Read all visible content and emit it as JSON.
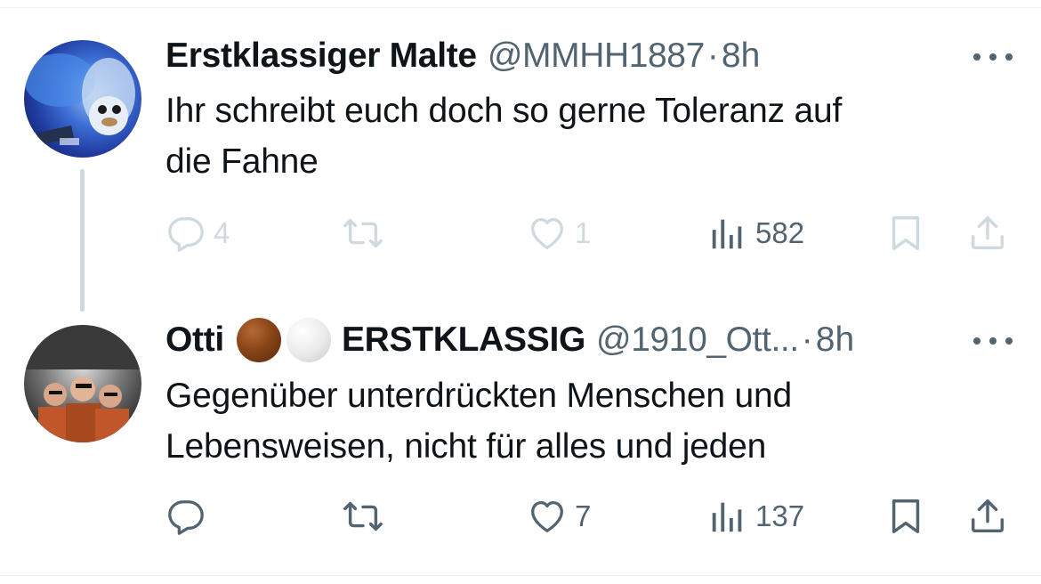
{
  "tweets": [
    {
      "name": "Erstklassiger Malte",
      "handle": "@MMHH1887",
      "separator": "·",
      "time": "8h",
      "text_lines": [
        "Ihr schreibt euch doch so gerne Toleranz auf",
        "die Fahne"
      ],
      "actions": {
        "replies": "4",
        "retweets": "",
        "likes": "1",
        "views": "582"
      },
      "icons": [
        "reply-icon",
        "retweet-icon",
        "heart-icon",
        "views-icon",
        "bookmark-icon",
        "share-icon",
        "more-icon"
      ]
    },
    {
      "name": "Otti",
      "name_suffix": "ERSTKLASSIG",
      "handle": "@1910_Ott...",
      "separator": "·",
      "time": "8h",
      "text_lines": [
        "Gegenüber unterdrückten Menschen und",
        "Lebensweisen, nicht für alles und jeden"
      ],
      "actions": {
        "replies": "",
        "retweets": "",
        "likes": "7",
        "views": "137"
      },
      "icons": [
        "reply-icon",
        "retweet-icon",
        "heart-icon",
        "views-icon",
        "bookmark-icon",
        "share-icon",
        "more-icon"
      ]
    }
  ],
  "colors": {
    "text_primary": "#0f1419",
    "text_secondary": "#536471",
    "faded": "#cfd9de",
    "thread_line": "#cfd9de",
    "emoji_brown": "#8a4517",
    "emoji_white": "#eaeaea"
  }
}
